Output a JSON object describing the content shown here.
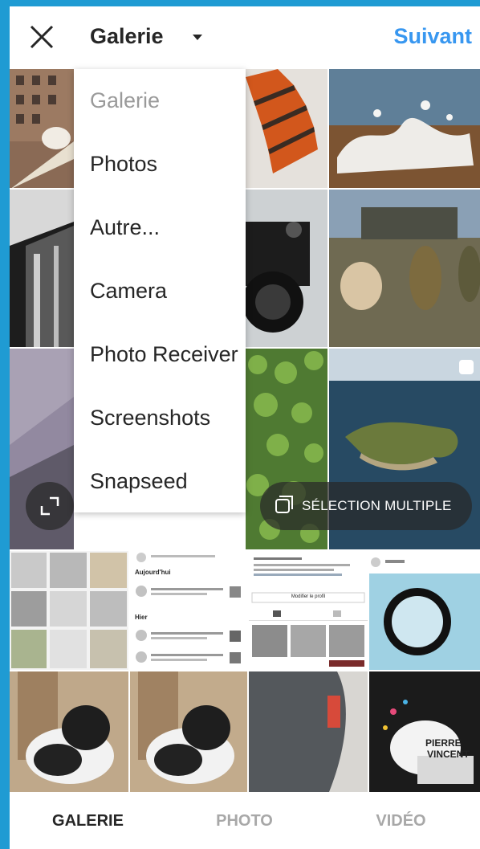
{
  "header": {
    "title": "Galerie",
    "next_label": "Suivant",
    "close_icon": "close-icon",
    "caret_icon": "caret-down-icon"
  },
  "menu": {
    "items": [
      "Galerie",
      "Photos",
      "Autre...",
      "Camera",
      "Photo Receiver",
      "Screenshots",
      "Snapseed"
    ]
  },
  "overlay": {
    "expand_icon": "expand-icon",
    "multi_select_label": "SÉLECTION MULTIPLE",
    "multi_select_icon": "multi-select-icon"
  },
  "screenshot_thumbs": {
    "today_label": "Aujourd'hui",
    "yesterday_label": "Hier",
    "edit_profile_label": "Modifier le profil"
  },
  "sticker": {
    "line1": "PIERRE",
    "line2": "VINCENT"
  },
  "tabs": {
    "gallery": "GALERIE",
    "photo": "PHOTO",
    "video": "VIDÉO"
  },
  "colors": {
    "accent": "#3897f0",
    "background": "#1f9bd3",
    "active_tab": "#262626",
    "inactive_tab": "#a8a8a8"
  }
}
